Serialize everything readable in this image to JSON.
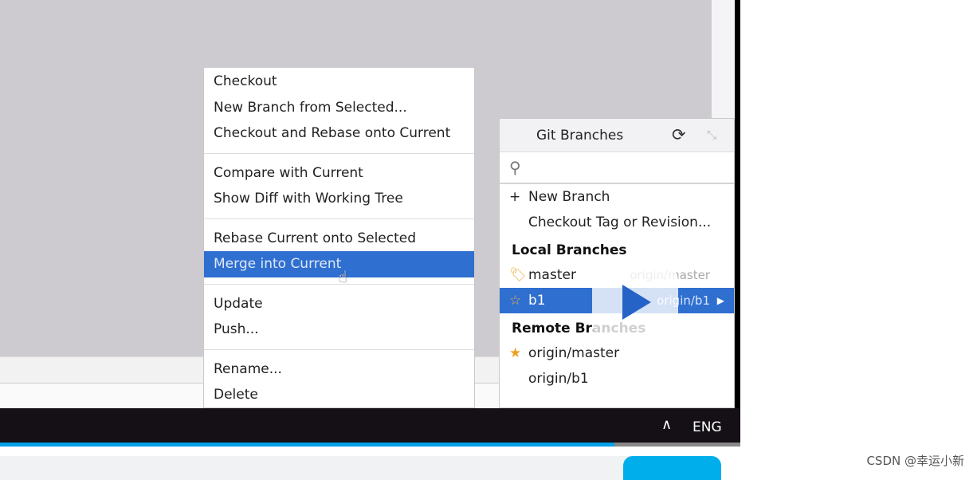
{
  "context_menu": {
    "groups": [
      [
        "Checkout",
        "New Branch from Selected...",
        "Checkout and Rebase onto Current"
      ],
      [
        "Compare with Current",
        "Show Diff with Working Tree"
      ],
      [
        "Rebase Current onto Selected",
        "Merge into Current"
      ],
      [
        "Update",
        "Push..."
      ],
      [
        "Rename...",
        "Delete"
      ]
    ],
    "selected": "Merge into Current"
  },
  "git_branches": {
    "title": "Git Branches",
    "search_placeholder": "",
    "actions": {
      "new_branch": "New Branch",
      "checkout_tag": "Checkout Tag or Revision..."
    },
    "local_header": "Local Branches",
    "local": [
      {
        "name": "master",
        "tracking": "origin/master",
        "icon": "tag-icon"
      },
      {
        "name": "b1",
        "tracking": "origin/b1",
        "icon": "star-outline-icon",
        "selected": true
      }
    ],
    "remote_header": "Remote Branches",
    "remote": [
      {
        "name": "origin/master",
        "icon": "star-filled-icon"
      },
      {
        "name": "origin/b1"
      }
    ]
  },
  "taskbar": {
    "language": "ENG"
  },
  "video_progress_percent": 83,
  "watermark": "CSDN @幸运小新",
  "colors": {
    "selection": "#2f6fd0",
    "progress": "#00a1e6",
    "taskbar": "#141016"
  }
}
